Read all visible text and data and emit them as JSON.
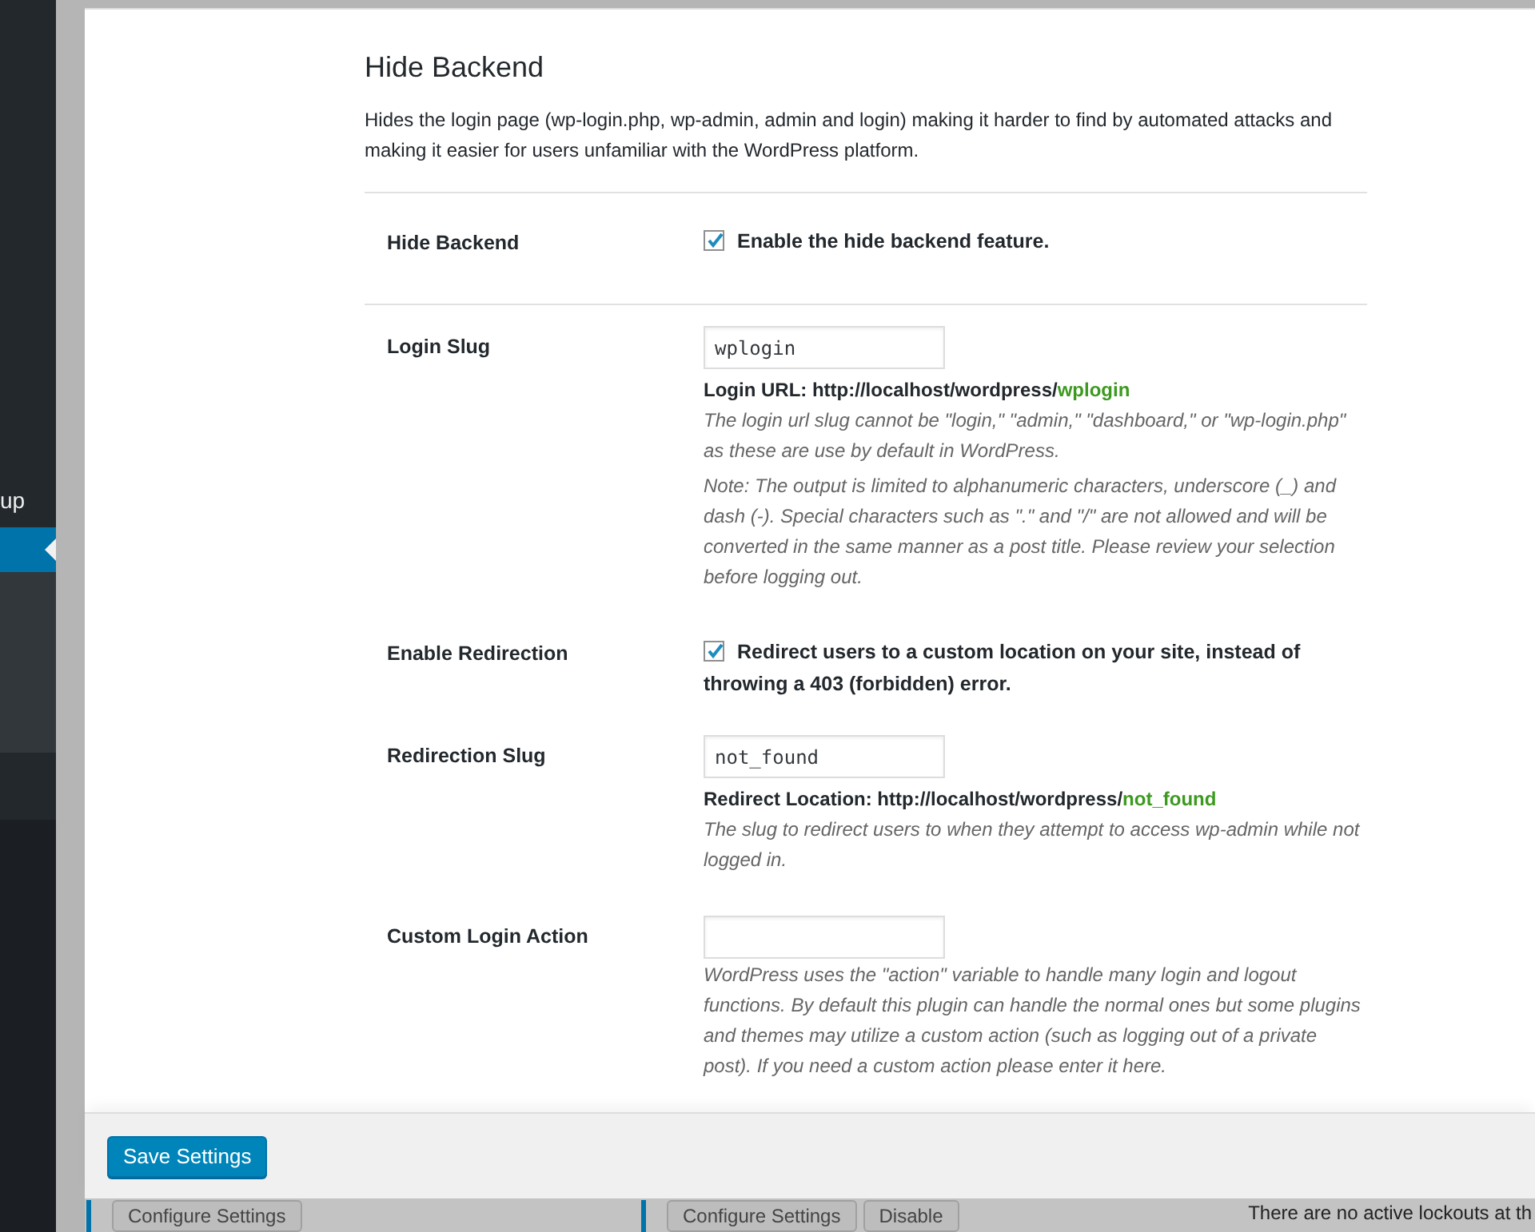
{
  "sidebar": {
    "items": [
      {
        "label": "up",
        "selected": false
      },
      {
        "selected": true
      }
    ]
  },
  "section": {
    "title": "Hide Backend",
    "description": "Hides the login page (wp-login.php, wp-admin, admin and login) making it harder to find by automated attacks and making it easier for users unfamiliar with the WordPress platform."
  },
  "rows": [
    {
      "kind": "checkbox",
      "label": "Hide Backend",
      "checked": true,
      "text": "Enable the hide backend feature."
    },
    {
      "kind": "text",
      "label": "Login Slug",
      "value": "wplogin",
      "url_label": "Login URL: http://localhost/wordpress/",
      "url_slug": "wplogin",
      "help": [
        "The login url slug cannot be \"login,\" \"admin,\" \"dashboard,\" or \"wp-login.php\" as these are use by default in WordPress.",
        "Note: The output is limited to alphanumeric characters, underscore (_) and dash (-). Special characters such as \".\" and \"/\" are not allowed and will be converted in the same manner as a post title. Please review your selection before logging out."
      ]
    },
    {
      "kind": "checkbox",
      "label": "Enable Redirection",
      "checked": true,
      "text": "Redirect users to a custom location on your site, instead of throwing a 403 (forbidden) error."
    },
    {
      "kind": "text",
      "label": "Redirection Slug",
      "value": "not_found",
      "url_label": "Redirect Location: http://localhost/wordpress/",
      "url_slug": "not_found",
      "help": [
        "The slug to redirect users to when they attempt to access wp-admin while not logged in."
      ]
    },
    {
      "kind": "text",
      "label": "Custom Login Action",
      "help": [
        "WordPress uses the \"action\" variable to handle many login and logout functions. By default this plugin can handle the normal ones but some plugins and themes may utilize a custom action (such as logging out of a private post). If you need a custom action please enter it here."
      ]
    }
  ],
  "footer": {
    "button": "Save Settings"
  },
  "background": {
    "buttons": [
      "Configure Settings",
      "Configure Settings",
      "Disable"
    ],
    "lockouts_text": "There are no active lockouts at th"
  }
}
